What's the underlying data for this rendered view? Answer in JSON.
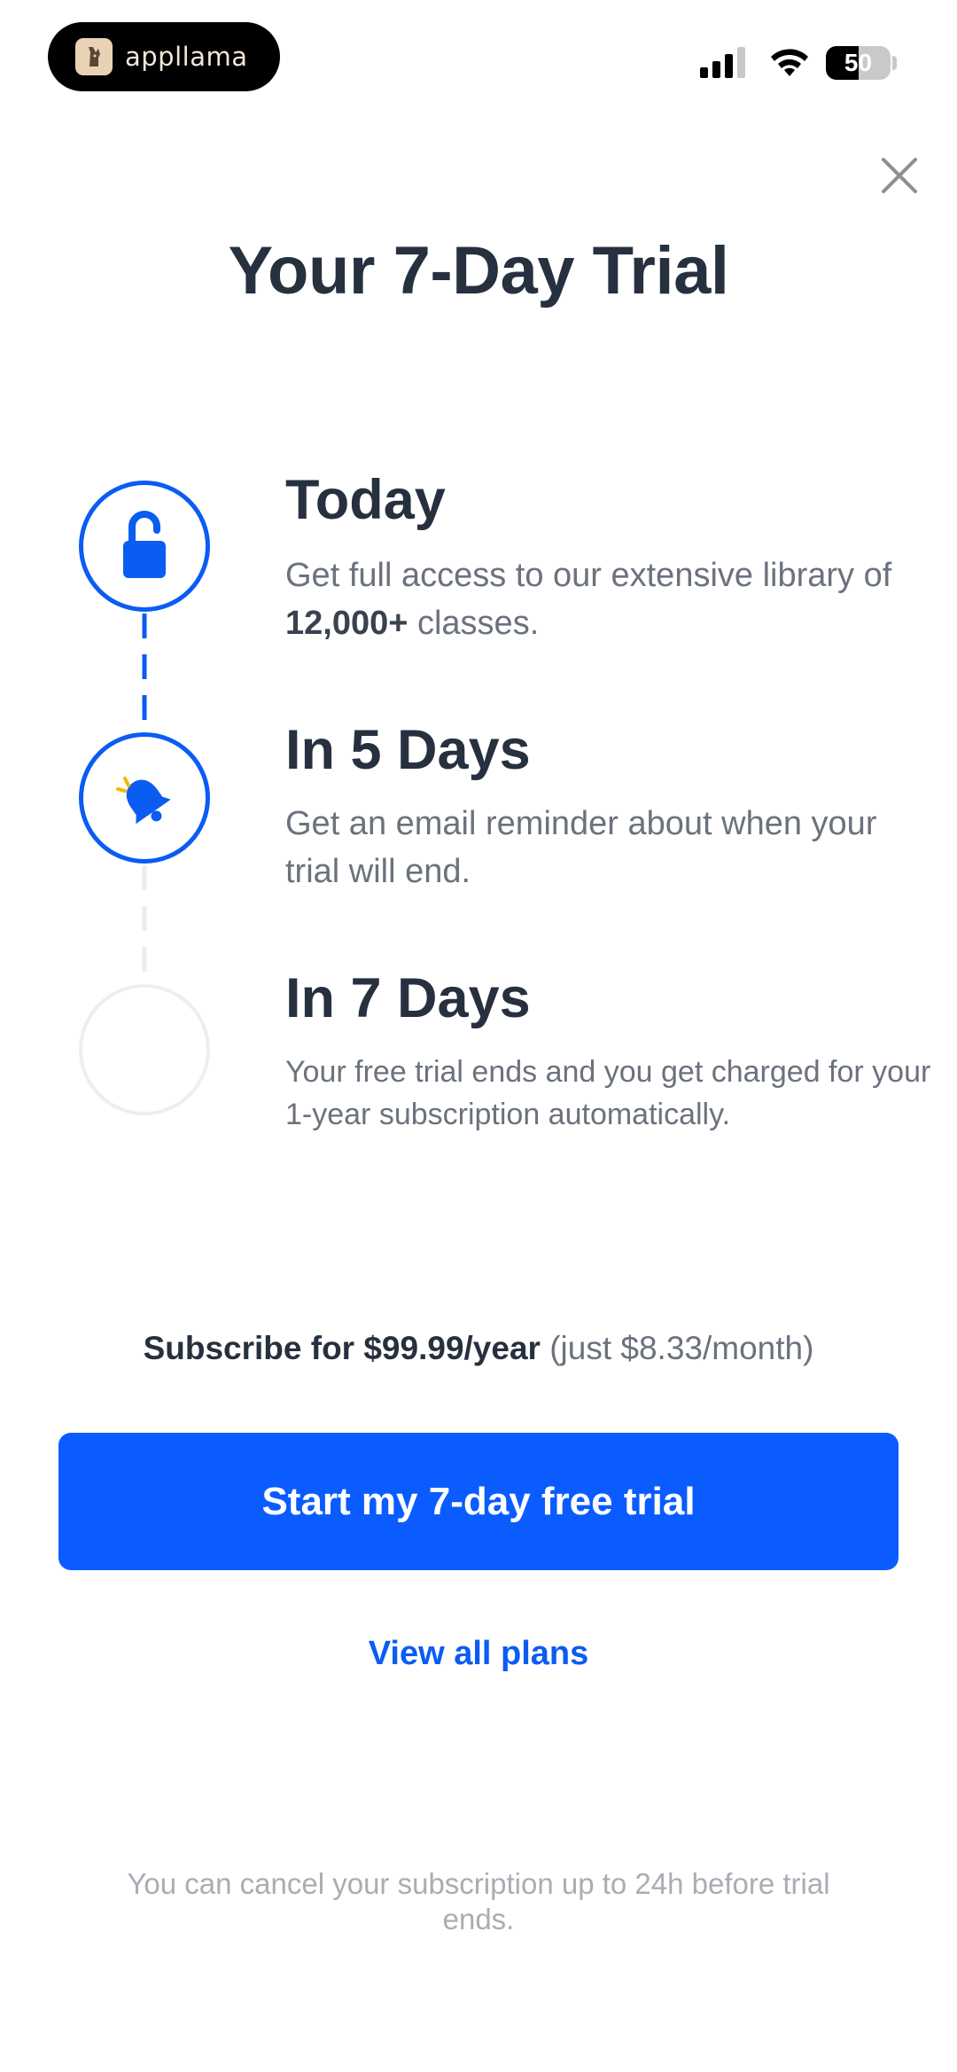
{
  "status_bar": {
    "app_name": "appllama",
    "battery_percent": "50",
    "battery_level": 0.5,
    "icons": [
      "cellular-signal-icon",
      "wifi-icon",
      "battery-icon"
    ]
  },
  "header": {
    "close_icon": "close-icon",
    "title": "Your 7-Day Trial"
  },
  "timeline": {
    "steps": [
      {
        "title": "Today",
        "desc_before": "Get full access to our extensive library of ",
        "desc_bold": "12,000+",
        "desc_after": " classes.",
        "icon": "unlock-icon",
        "active": true
      },
      {
        "title": "In 5 Days",
        "desc": "Get an email reminder about when your trial will end.",
        "icon": "bell-icon",
        "active": true
      },
      {
        "title": "In 7 Days",
        "desc": "Your free trial ends and you get charged for your 1-year subscription automatically.",
        "icon": "",
        "active": false
      }
    ]
  },
  "pricing": {
    "strong": "Subscribe for $99.99/year",
    "light": " (just $8.33/month)"
  },
  "actions": {
    "cta_label": "Start my 7-day free trial",
    "view_plans_label": "View all plans"
  },
  "footer": {
    "note": "You can cancel your subscription up to 24h before trial ends."
  },
  "colors": {
    "accent": "#0a5cff",
    "title_text": "#27303f",
    "body_text": "#6b727d",
    "muted_text": "#a9adb3"
  }
}
